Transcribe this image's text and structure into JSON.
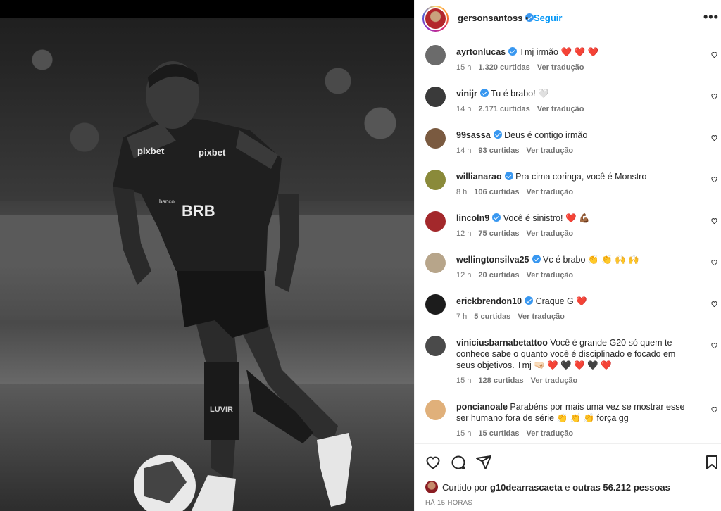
{
  "post": {
    "owner": "gersonsantoss",
    "dot": "•",
    "follow_label": "Seguir",
    "more_label": "•••",
    "photo": {
      "shirt_sponsor_left": "pixbet",
      "shirt_sponsor_right": "pixbet",
      "shirt_bank_small": "banco",
      "shirt_bank": "BRB",
      "sock_text": "LUVIR"
    }
  },
  "comments": [
    {
      "user": "ayrtonlucas",
      "text": "Tmj irmão ❤️ ❤️ ❤️",
      "time": "15 h",
      "likes": "1.320 curtidas",
      "translate": "Ver tradução",
      "avatar_color": "#6b6b6b"
    },
    {
      "user": "vinijr",
      "text": "Tu é brabo! 🤍",
      "time": "14 h",
      "likes": "2.171 curtidas",
      "translate": "Ver tradução",
      "avatar_color": "#3a3a3a"
    },
    {
      "user": "99sassa",
      "text": "Deus é contigo irmão",
      "time": "14 h",
      "likes": "93 curtidas",
      "translate": "Ver tradução",
      "avatar_color": "#7a5a40"
    },
    {
      "user": "willianarao",
      "text": "Pra cima coringa, você é Monstro",
      "time": "8 h",
      "likes": "106 curtidas",
      "translate": "Ver tradução",
      "avatar_color": "#8a8a3a"
    },
    {
      "user": "lincoln9",
      "text": "Você é sinistro! ❤️ 💪🏾",
      "time": "12 h",
      "likes": "75 curtidas",
      "translate": "Ver tradução",
      "avatar_color": "#a3282b"
    },
    {
      "user": "wellingtonsilva25",
      "text": "Vc é brabo 👏 👏 🙌 🙌",
      "time": "12 h",
      "likes": "20 curtidas",
      "translate": "Ver tradução",
      "avatar_color": "#b7a58a"
    },
    {
      "user": "erickbrendon10",
      "text": "Craque G ❤️",
      "time": "7 h",
      "likes": "5 curtidas",
      "translate": "Ver tradução",
      "avatar_color": "#1c1c1c"
    },
    {
      "user": "viniciusbarnabetattoo",
      "text": "Você é grande G20 só quem te conhece sabe o quanto você é disciplinado e focado em seus objetivos. Tmj 🤜🏻 ❤️ 🖤 ❤️ 🖤 ❤️",
      "time": "15 h",
      "likes": "128 curtidas",
      "translate": "Ver tradução",
      "avatar_color": "#4a4a4a"
    },
    {
      "user": "poncianoale",
      "text": "Parabéns por mais uma vez se mostrar esse ser humano fora de série 👏 👏 👏 força gg",
      "time": "15 h",
      "likes": "15 curtidas",
      "translate": "Ver tradução",
      "avatar_color": "#e0b07a"
    }
  ],
  "footer": {
    "liked_prefix": "Curtido por",
    "liked_user": "g10dearrascaeta",
    "liked_and": "e",
    "liked_others": "outras 56.212 pessoas",
    "time": "HÁ 15 HORAS"
  }
}
